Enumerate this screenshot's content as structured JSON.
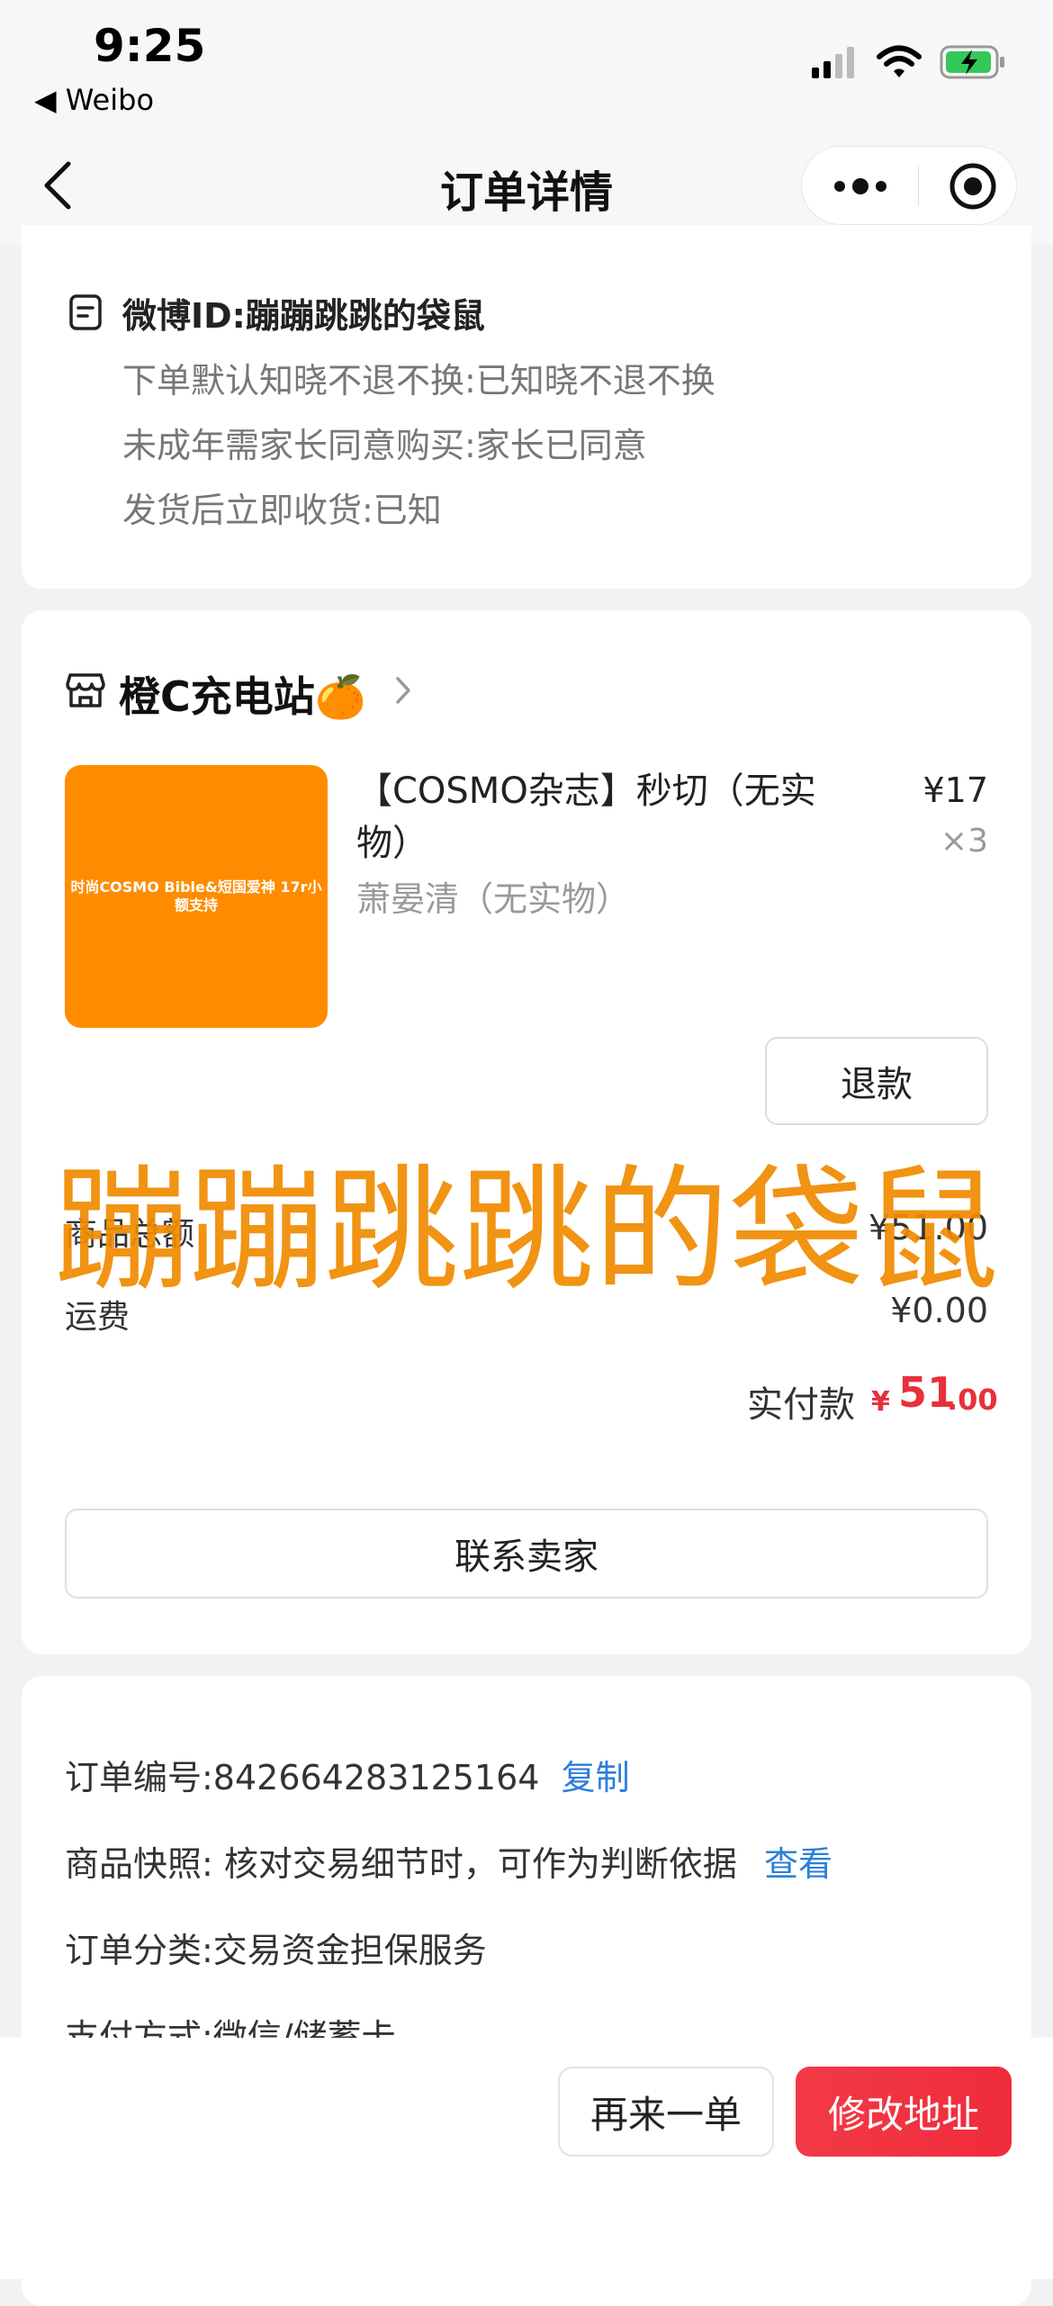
{
  "status_bar": {
    "time": "9:25",
    "back_app": "◀ Weibo"
  },
  "nav": {
    "title": "订单详情"
  },
  "buyer_info": {
    "title": "微博ID:蹦蹦跳跳的袋鼠",
    "lines": [
      "下单默认知晓不退不换:已知晓不退不换",
      "未成年需家长同意购买:家长已同意",
      "发货后立即收货:已知"
    ]
  },
  "shop": {
    "name": "橙C充电站🍊"
  },
  "product": {
    "thumb_text": "时尚COSMO Bible&短国爱神 17r小额支持",
    "title": "【COSMO杂志】秒切（无实物）",
    "spec": "萧晏清（无实物）",
    "price": "¥17",
    "qty": "×3",
    "refund_label": "退款"
  },
  "summary": {
    "goods_label": "商品总额",
    "goods_value": "¥51.00",
    "shipping_label": "运费",
    "shipping_value": "¥0.00",
    "paid_label": "实付款",
    "paid_currency": "¥",
    "paid_int": "51",
    "paid_dec": ".00",
    "contact_label": "联系卖家"
  },
  "watermark": "蹦蹦跳跳的袋鼠",
  "order_info": {
    "order_no": "订单编号:842664283125164",
    "copy_label": "复制",
    "snapshot": "商品快照: 核对交易细节时，可作为判断依据",
    "view_label": "查看",
    "category": "订单分类:交易资金担保服务",
    "payment": "支付方式:微信/储蓄卡"
  },
  "bottom_bar": {
    "again_label": "再来一单",
    "address_label": "修改地址"
  },
  "colors": {
    "accent_red": "#e8303a",
    "link_blue": "#2a7fd8",
    "watermark_orange": "#f08a00",
    "thumb_orange": "#ff8c00"
  },
  "icons": [
    "signal-icon",
    "wifi-icon",
    "battery-charging-icon",
    "back-arrow-icon",
    "more-icon",
    "close-target-icon",
    "note-icon",
    "shop-icon",
    "chevron-right-icon"
  ]
}
